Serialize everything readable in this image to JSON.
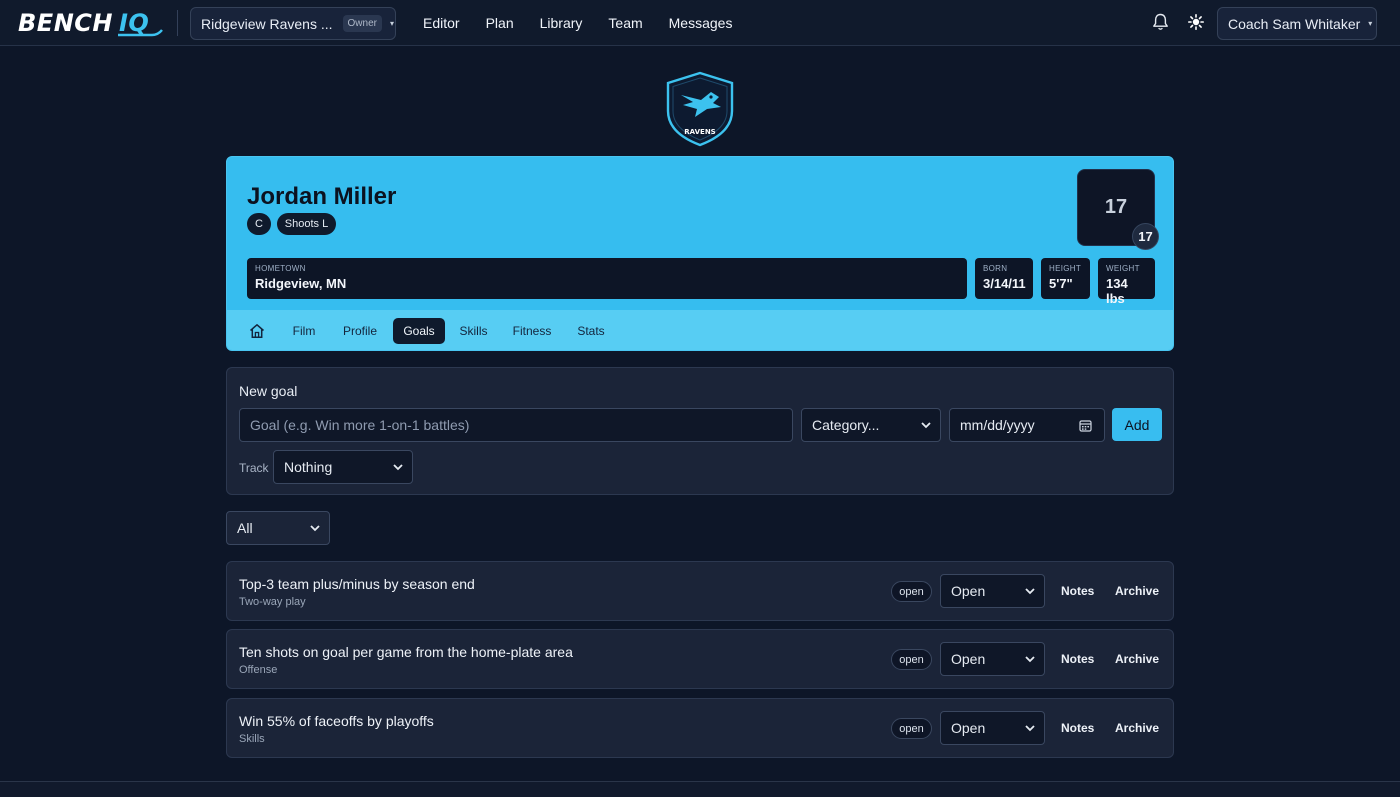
{
  "brand": {
    "word": "BENCH",
    "accent": "IQ"
  },
  "team_selector": {
    "name": "Ridgeview Ravens ...",
    "role_badge": "Owner"
  },
  "nav": [
    "Editor",
    "Plan",
    "Library",
    "Team",
    "Messages"
  ],
  "user_menu": {
    "name": "Coach Sam Whitaker"
  },
  "crest": {
    "text": "RAVENS"
  },
  "player": {
    "name": "Jordan Miller",
    "position": "C",
    "shoots": "Shoots L",
    "number": "17",
    "number_badge": "17",
    "hometown_label": "HOMETOWN",
    "hometown": "Ridgeview, MN",
    "born_label": "BORN",
    "born": "3/14/11",
    "height_label": "HEIGHT",
    "height": "5'7\"",
    "weight_label": "WEIGHT",
    "weight": "134 lbs"
  },
  "tabs": [
    "Film",
    "Profile",
    "Goals",
    "Skills",
    "Fitness",
    "Stats"
  ],
  "active_tab": "Goals",
  "new_goal": {
    "title": "New goal",
    "goal_placeholder": "Goal (e.g. Win more 1-on-1 battles)",
    "category_value": "Category...",
    "date_placeholder": "mm/dd/yyyy",
    "add_label": "Add",
    "track_label": "Track",
    "track_value": "Nothing"
  },
  "filter_value": "All",
  "goals": [
    {
      "title": "Top-3 team plus/minus by season end",
      "category": "Two-way play",
      "badge": "open",
      "status": "Open",
      "notes": "Notes",
      "archive": "Archive"
    },
    {
      "title": "Ten shots on goal per game from the home-plate area",
      "category": "Offense",
      "badge": "open",
      "status": "Open",
      "notes": "Notes",
      "archive": "Archive"
    },
    {
      "title": "Win 55% of faceoffs by playoffs",
      "category": "Skills",
      "badge": "open",
      "status": "Open",
      "notes": "Notes",
      "archive": "Archive"
    }
  ],
  "colors": {
    "accent": "#36bdef",
    "background": "#0d1628",
    "card": "#1b2438",
    "chip": "#0f1a2c"
  },
  "icons": [
    "bell-icon",
    "theme-toggle-icon",
    "home-icon",
    "calendar-icon",
    "chevron-down-icon"
  ]
}
